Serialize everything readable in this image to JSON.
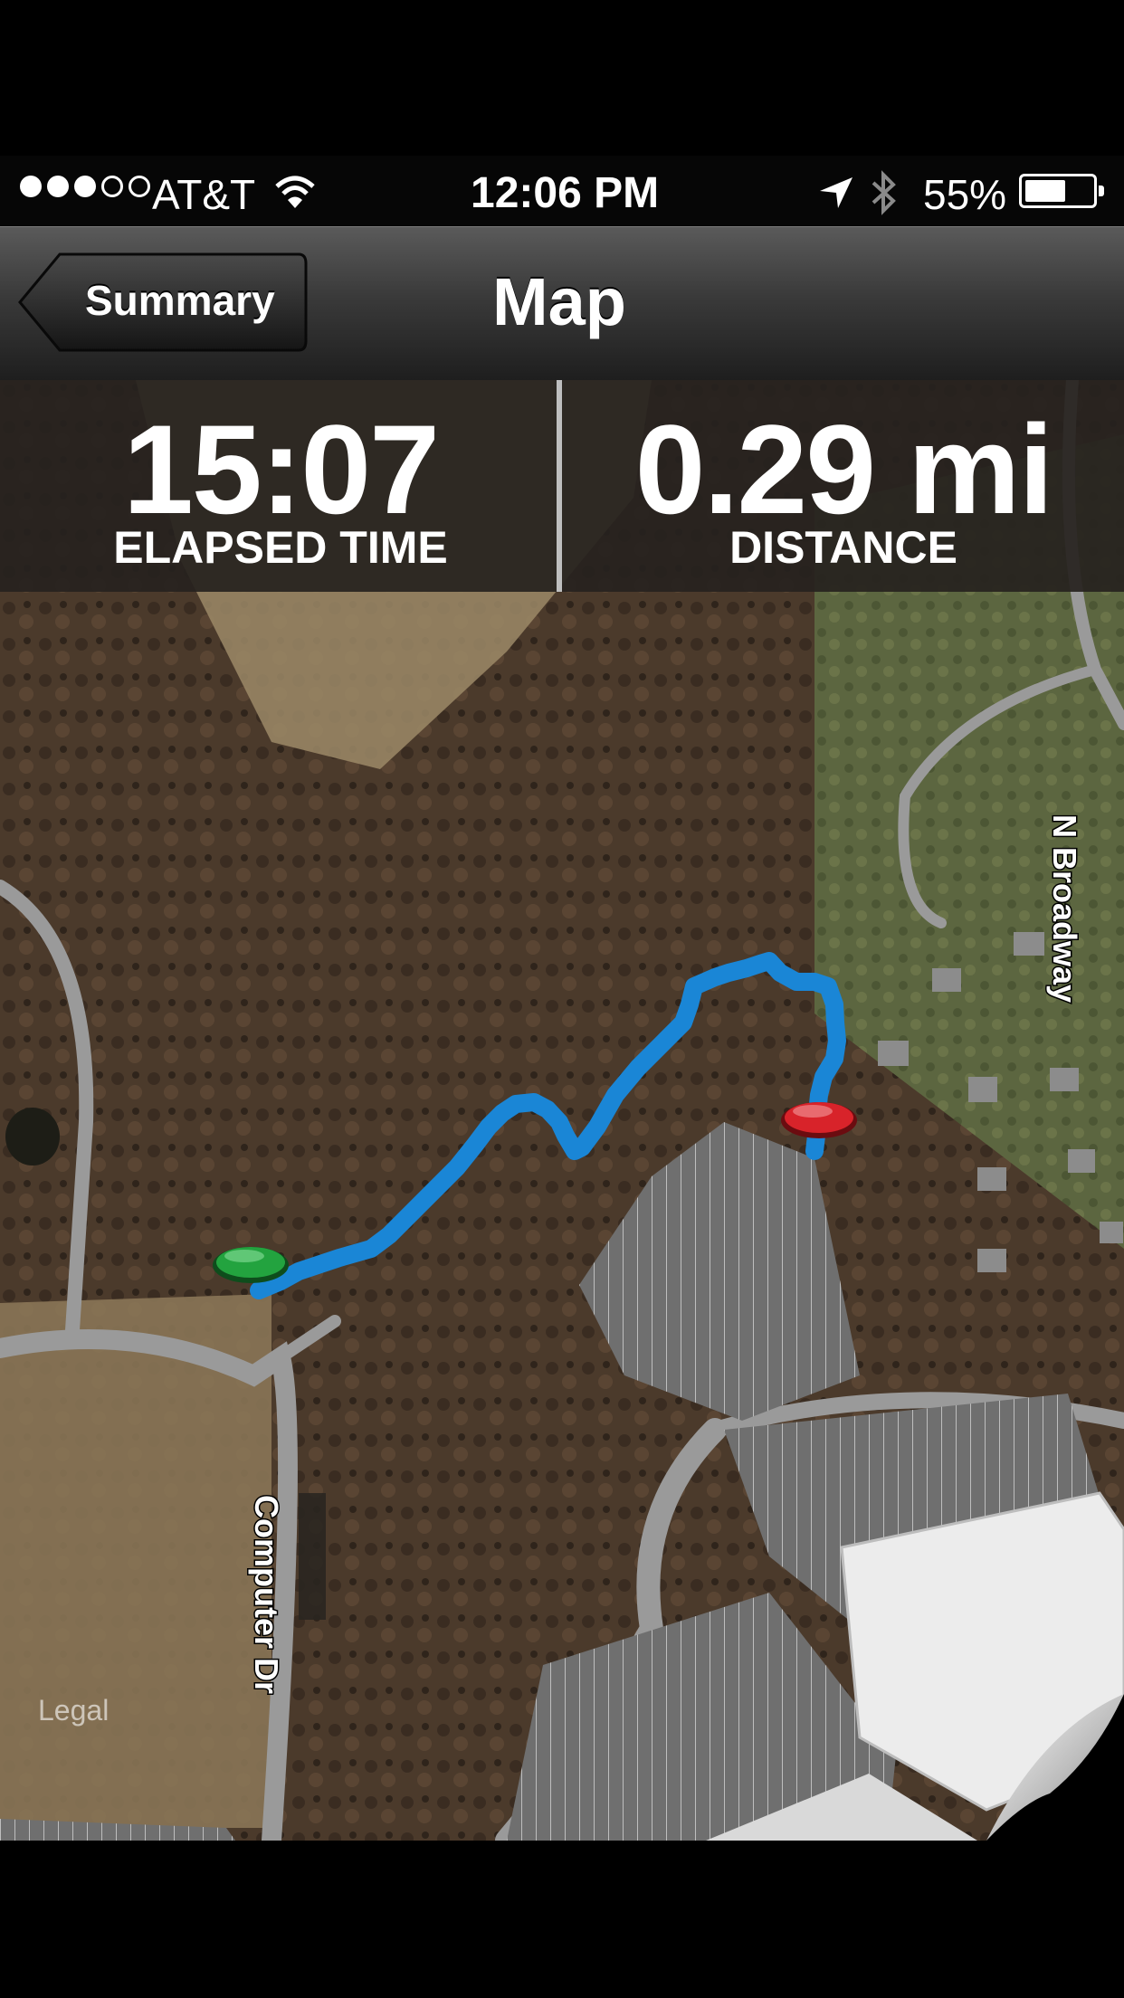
{
  "status_bar": {
    "signal": {
      "filled": 3,
      "total": 5
    },
    "carrier": "AT&T",
    "time": "12:06 PM",
    "battery_percent": "55%",
    "battery_level": 0.55
  },
  "nav": {
    "back_label": "Summary",
    "title": "Map"
  },
  "stats": {
    "elapsed_value": "15:07",
    "elapsed_label": "ELAPSED TIME",
    "distance_value": "0.29 mi",
    "distance_label": "DISTANCE"
  },
  "map": {
    "roads": [
      "N Broadway",
      "Computer Dr"
    ],
    "legal": "Legal",
    "route_color": "#1a86d6",
    "start_color": "#1f9a3a",
    "end_color": "#d8232a"
  }
}
